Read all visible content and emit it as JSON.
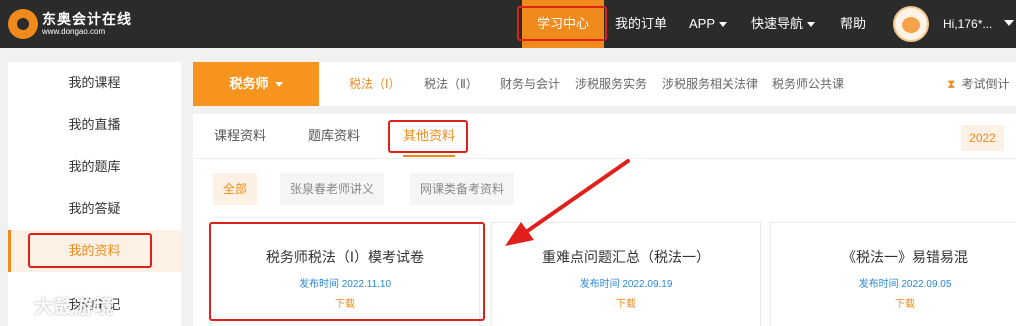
{
  "header": {
    "brand": "东奥会计在线",
    "brand_url": "www.dongao.com",
    "nav": [
      "学习中心",
      "我的订单",
      "APP",
      "快速导航",
      "帮助"
    ],
    "greeting": "Hi,176*..."
  },
  "sidebar": {
    "items": [
      "我的课程",
      "我的直播",
      "我的题库",
      "我的答疑",
      "我的资料",
      "我的笔记"
    ]
  },
  "course": {
    "selected": "税务师",
    "subjects": [
      "税法（Ⅰ）",
      "税法（Ⅱ）",
      "财务与会计",
      "涉税服务实务",
      "涉税服务相关法律",
      "税务师公共课"
    ],
    "countdown": "考试倒计"
  },
  "tabs": [
    "课程资料",
    "题库资料",
    "其他资料"
  ],
  "year": "2022",
  "filters": [
    "全部",
    "张泉春老师讲义",
    "网课类备考资料"
  ],
  "cards": [
    {
      "title": "税务师税法（Ⅰ）模考试卷",
      "date": "发布时间 2022.11.10",
      "download": "下载"
    },
    {
      "title": "重难点问题汇总（税法一）",
      "date": "发布时间 2022.09.19",
      "download": "下载"
    },
    {
      "title": "《税法一》易错易混",
      "date": "发布时间 2022.09.05",
      "download": "下载"
    }
  ],
  "watermark": "大鼓游境",
  "colors": {
    "accent": "#f08a1c",
    "topbar": "#2b2b2b",
    "highlight_box": "#e0201b",
    "date_blue": "#2b87d8"
  }
}
